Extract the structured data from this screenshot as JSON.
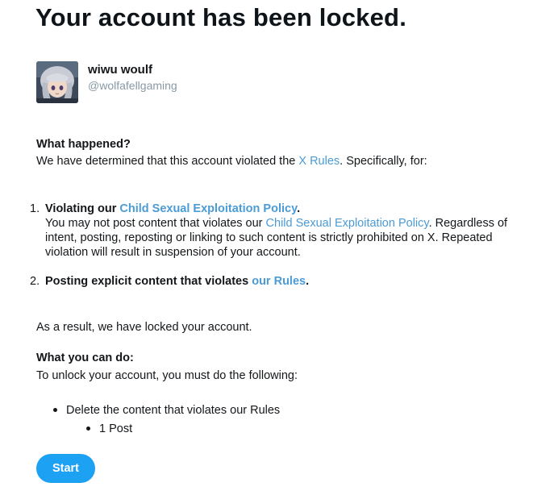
{
  "page": {
    "title": "Your account has been locked."
  },
  "account": {
    "display_name": "wiwu woulf",
    "handle": "@wolfafellgaming"
  },
  "what_happened": {
    "heading": "What happened?",
    "text_before": "We have determined that this account violated the ",
    "rules_link": "X Rules",
    "text_after": ". Specifically, for:"
  },
  "violations": [
    {
      "number": "1.",
      "title_prefix": "Violating our ",
      "title_link": "Child Sexual Exploitation Policy",
      "title_suffix": ".",
      "desc_before": "You may not post content that violates our ",
      "desc_link": "Child Sexual Exploitation Policy",
      "desc_after": ". Regardless of",
      "desc_line2": "intent, posting, reposting or linking to such content is strictly prohibited on X. Repeated",
      "desc_line3": "violation will result in suspension of your account."
    },
    {
      "number": "2.",
      "title_prefix": "Posting explicit content that violates ",
      "title_link": "our Rules",
      "title_suffix": "."
    }
  ],
  "result_text": "As a result, we have locked your account.",
  "what_you_can_do": {
    "heading": "What you can do:",
    "text": "To unlock your account, you must do the following:",
    "items": [
      {
        "label": "Delete the content that violates our Rules",
        "sub_items": [
          "1 Post"
        ]
      }
    ]
  },
  "actions": {
    "start_label": "Start"
  },
  "colors": {
    "link": "#4a9bd6",
    "button": "#1da1f2",
    "handle": "#8899a6"
  }
}
